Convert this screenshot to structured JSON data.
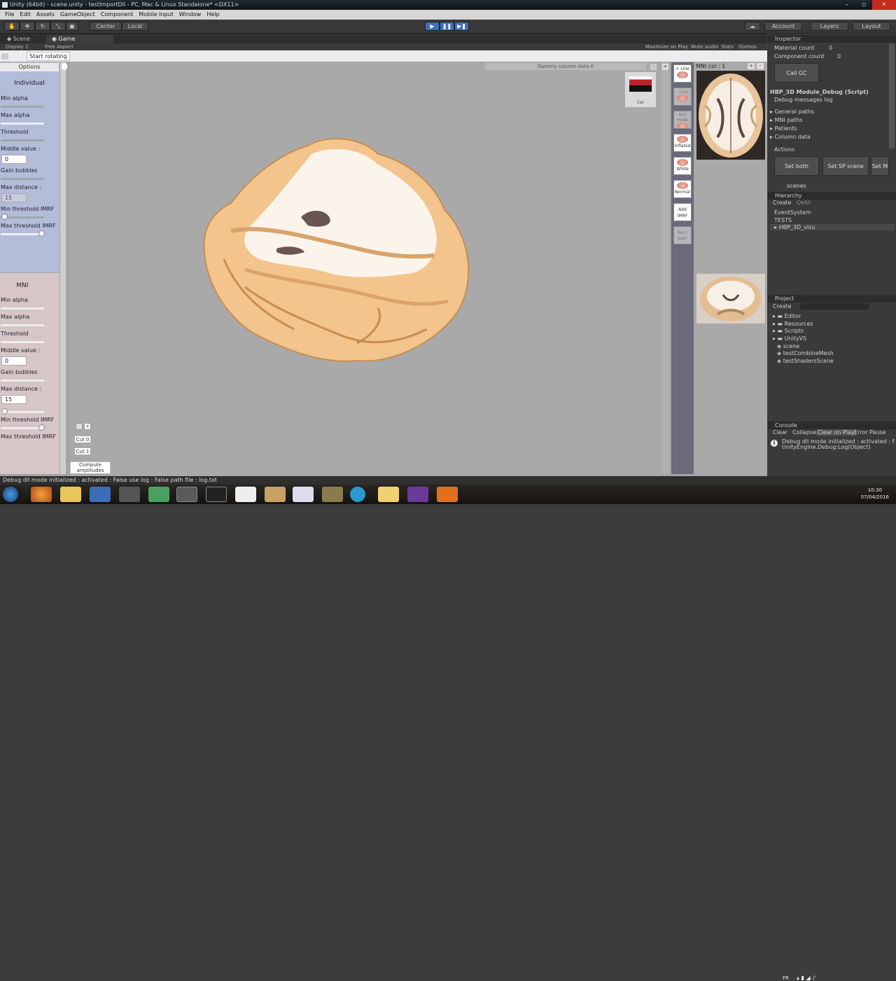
{
  "window": {
    "title": "Unity (64bit) - scene.unity - testImportDll - PC, Mac & Linux Standalone* <DX11>"
  },
  "menu": [
    "File",
    "Edit",
    "Assets",
    "GameObject",
    "Component",
    "Mobile Input",
    "Window",
    "Help"
  ],
  "toolbar": {
    "center": "Center",
    "local": "Local",
    "account": "Account",
    "layers": "Layers",
    "layout": "Layout"
  },
  "tabs": {
    "scene": "Scene",
    "game": "Game"
  },
  "gamebar": {
    "display": "Display 1",
    "aspect": "Free Aspect",
    "maximize": "Maximize on Play",
    "mute": "Mute audio",
    "stats": "Stats",
    "gizmos": "Gizmos"
  },
  "game": {
    "start_rotating": "Start rotating",
    "options": "Options",
    "individual": {
      "title": "Individual",
      "min_alpha": "Min alpha",
      "max_alpha": "Max alpha",
      "threshold": "Threshold",
      "middle_value": "Middle value :",
      "middle_input": "0",
      "gain_bubbles": "Gain bubbles",
      "max_distance": "Max distance :",
      "distance_input": "15",
      "min_threshold": "Min threshold IMRF",
      "max_threshold": "Max threshold IMRF"
    },
    "mni": {
      "title": "MNI",
      "min_alpha": "Min alpha",
      "max_alpha": "Max alpha",
      "threshold": "Threshold",
      "middle_value": "Middle value :",
      "middle_input": "0",
      "gain_bubbles": "Gain bubbles",
      "max_distance": "Max distance :",
      "distance_input": "15",
      "min_threshold": "Min threshold IMRF",
      "max_threshold": "Max threshold IMRF"
    },
    "dummy_column": "Dummy column data 0",
    "car_label": "Car",
    "side_buttons": [
      "+ Line",
      "- Line",
      "ROI mode",
      "Inflated",
      "White",
      "Normal",
      "Add IMRF",
      "Rem. IMRF"
    ],
    "mni_col": "MNI col : 1",
    "cuts": [
      "Cut 0",
      "Cut 1"
    ],
    "compute": "Compute amplitudes"
  },
  "inspector": {
    "title": "Inspector",
    "material_count_label": "Material count",
    "material_count": "0",
    "component_count_label": "Component count",
    "component_count": "0",
    "call_gc": "Call GC",
    "script": "HBP_3D Module_Debug (Script)",
    "debug_messages": "Debug messages log",
    "foldouts": [
      "General paths",
      "MNI paths",
      "Patients",
      "Column data"
    ],
    "actions": "Actions",
    "action_buttons": [
      "Set both scenes",
      "Set SP scene",
      "Set M"
    ]
  },
  "hierarchy": {
    "title": "Hierarchy",
    "create": "Create",
    "search": "Q▾All",
    "items": [
      "EventSystem",
      "TESTS",
      "HBP_3D_visu"
    ]
  },
  "project": {
    "title": "Project",
    "create": "Create",
    "items": [
      "Editor",
      "Resources",
      "Scripts",
      "UnityVS",
      "scene",
      "testCombineMesh",
      "testShadersScene"
    ]
  },
  "console": {
    "title": "Console",
    "buttons": [
      "Clear",
      "Collapse",
      "Clear on Play",
      "Error Pause"
    ],
    "line1": "Debug dll mode initialized : activated : False use log : Fal",
    "line2": "UnityEngine.Debug:Log(Object)"
  },
  "status": "Debug dll mode initialized : activated : False use log : False path file : log.txt",
  "taskbar": {
    "lang": "FR",
    "time": "10:30",
    "date": "07/04/2016"
  }
}
